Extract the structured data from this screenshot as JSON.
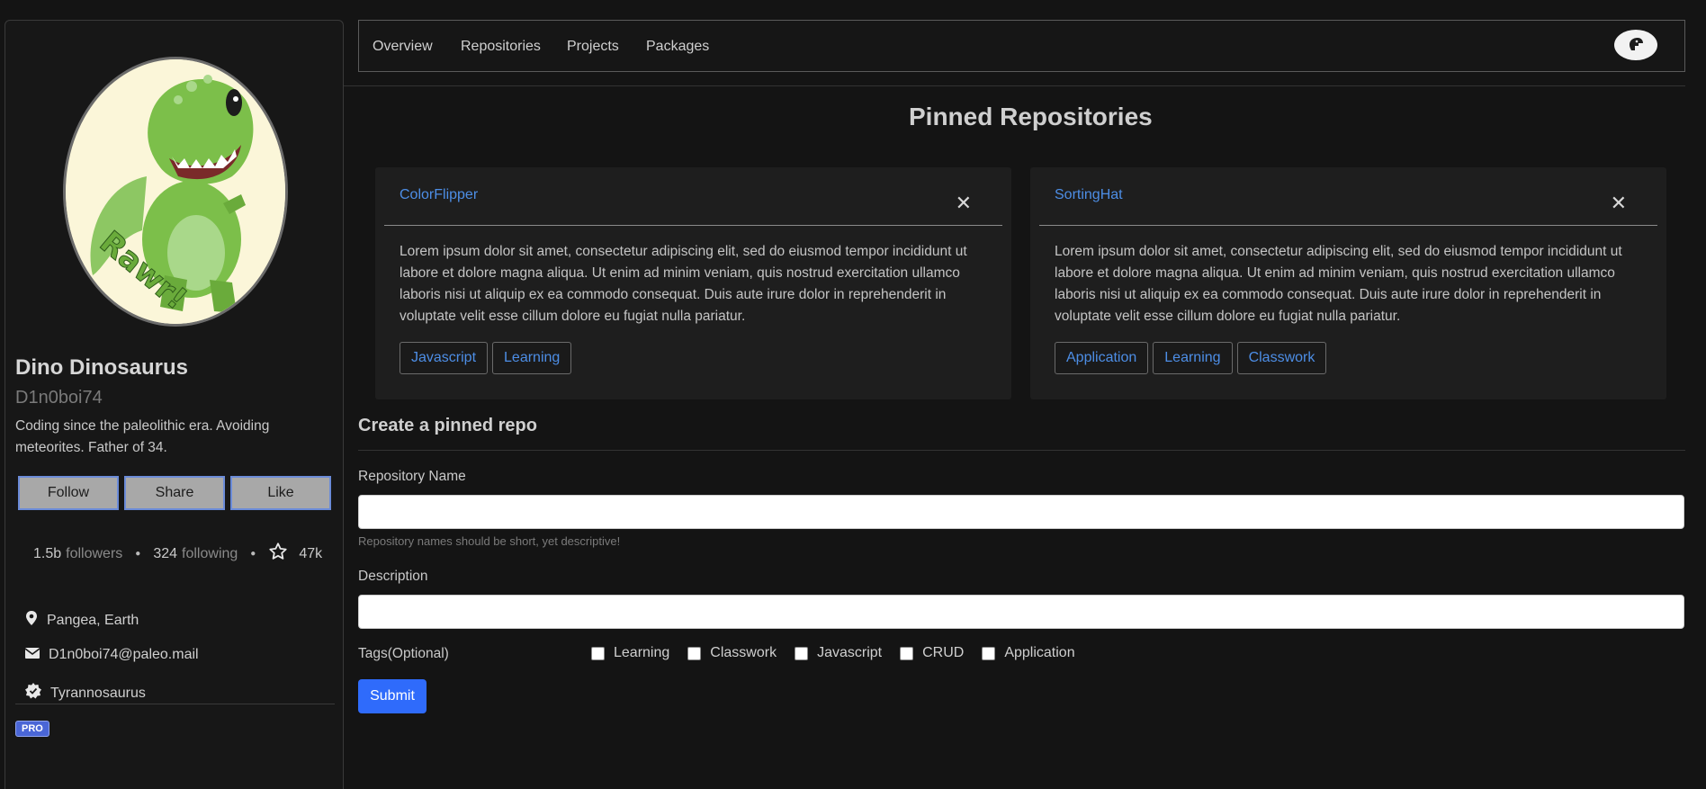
{
  "profile": {
    "name": "Dino Dinosaurus",
    "handle": "D1n0boi74",
    "bio": "Coding since the paleolithic era. Avoiding meteorites. Father of 34.",
    "buttons": {
      "follow": "Follow",
      "share": "Share",
      "like": "Like"
    },
    "stats": {
      "followers_count": "1.5b",
      "followers_label": "followers",
      "following_count": "324",
      "following_label": "following",
      "stars_count": "47k"
    },
    "location": "Pangea, Earth",
    "email": "D1n0boi74@paleo.mail",
    "species": "Tyrannosaurus",
    "badge": "PRO",
    "avatar_text": "Rawr!"
  },
  "nav": {
    "items": [
      "Overview",
      "Repositories",
      "Projects",
      "Packages"
    ]
  },
  "pinned": {
    "title": "Pinned Repositories",
    "cards": [
      {
        "name": "ColorFlipper",
        "description": "Lorem ipsum dolor sit amet, consectetur adipiscing elit, sed do eiusmod tempor incididunt ut labore et dolore magna aliqua. Ut enim ad minim veniam, quis nostrud exercitation ullamco laboris nisi ut aliquip ex ea commodo consequat. Duis aute irure dolor in reprehenderit in voluptate velit esse cillum dolore eu fugiat nulla pariatur.",
        "tags": [
          "Javascript",
          "Learning"
        ]
      },
      {
        "name": "SortingHat",
        "description": "Lorem ipsum dolor sit amet, consectetur adipiscing elit, sed do eiusmod tempor incididunt ut labore et dolore magna aliqua. Ut enim ad minim veniam, quis nostrud exercitation ullamco laboris nisi ut aliquip ex ea commodo consequat. Duis aute irure dolor in reprehenderit in voluptate velit esse cillum dolore eu fugiat nulla pariatur.",
        "tags": [
          "Application",
          "Learning",
          "Classwork"
        ]
      }
    ]
  },
  "form": {
    "title": "Create a pinned repo",
    "repo_name_label": "Repository Name",
    "repo_name_value": "",
    "repo_name_help": "Repository names should be short, yet descriptive!",
    "description_label": "Description",
    "description_value": "",
    "tags_label": "Tags(Optional)",
    "tag_options": [
      "Learning",
      "Classwork",
      "Javascript",
      "CRUD",
      "Application"
    ],
    "submit_label": "Submit"
  },
  "icons": {
    "close": "close-icon",
    "location": "map-pin-icon",
    "email": "mail-icon",
    "verified": "verified-badge-icon",
    "star": "star-icon"
  },
  "colors": {
    "link": "#4d8ee6",
    "submit": "#2f6bfb",
    "pro_badge": "#4a66d6",
    "dino_green": "#7cbf4a"
  }
}
